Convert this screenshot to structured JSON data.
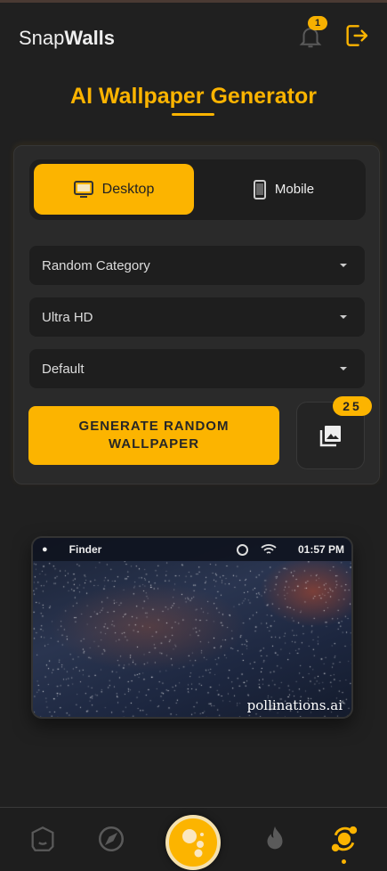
{
  "header": {
    "brand_light": "Snap",
    "brand_bold": "Walls",
    "notification_count": "1",
    "bell_icon": "bell-icon",
    "logout_icon": "logout-icon"
  },
  "page": {
    "title": "AI Wallpaper Generator"
  },
  "device_toggle": {
    "desktop": "Desktop",
    "mobile": "Mobile",
    "selected": "Desktop"
  },
  "selects": [
    {
      "value": "Random Category"
    },
    {
      "value": "Ultra HD"
    },
    {
      "value": "Default"
    }
  ],
  "generate_label": "GENERATE RANDOM WALLPAPER",
  "gallery_count": "25",
  "preview": {
    "menu_app": "Finder",
    "time": "01:57 PM",
    "watermark": "pollinations.ai"
  },
  "colors": {
    "accent": "#fcb400",
    "background": "#202020",
    "card": "#2a2a2a"
  },
  "bottom_nav": {
    "items": [
      "home-icon",
      "compass-icon",
      "create-icon",
      "fire-icon",
      "orbit-icon"
    ],
    "active": "orbit-icon"
  }
}
